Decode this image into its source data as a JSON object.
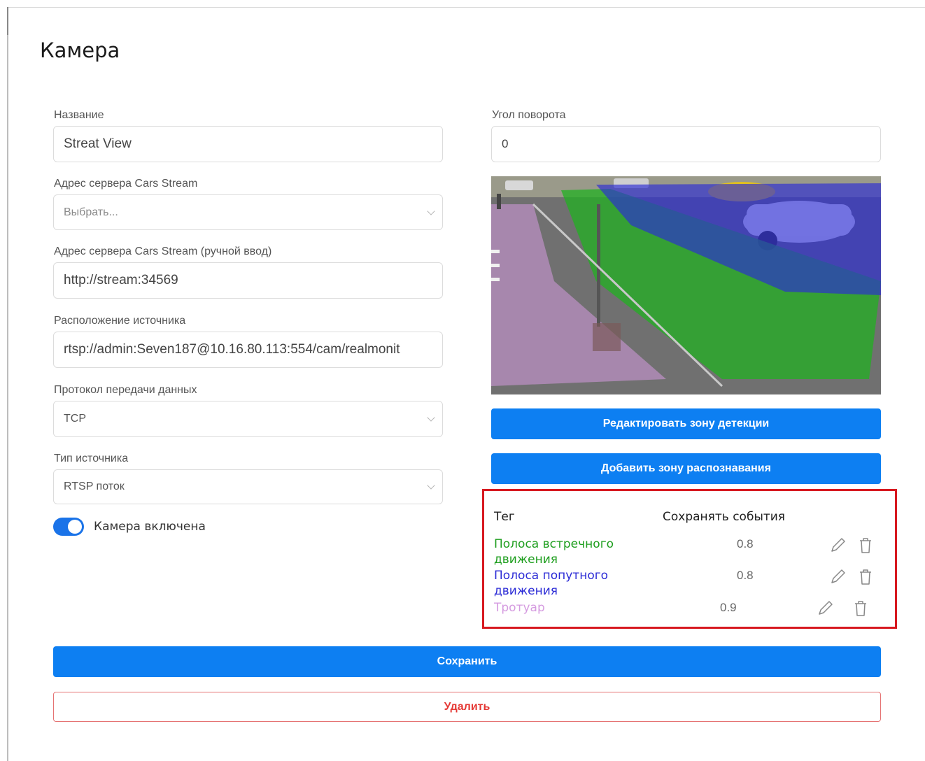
{
  "page": {
    "title": "Камера"
  },
  "form": {
    "name": {
      "label": "Название",
      "value": "Streat View"
    },
    "server": {
      "label": "Адрес сервера Cars Stream",
      "placeholder": "Выбрать..."
    },
    "server_manual": {
      "label": "Адрес сервера Cars Stream (ручной ввод)",
      "value": "http://stream:34569"
    },
    "source_location": {
      "label": "Расположение источника",
      "value": "rtsp://admin:Seven187@10.16.80.113:554/cam/realmonit"
    },
    "protocol": {
      "label": "Протокол передачи данных",
      "value": "TCP"
    },
    "source_type": {
      "label": "Тип источника",
      "value": "RTSP поток"
    },
    "camera_enabled": {
      "label": "Камера включена",
      "checked": true
    },
    "rotation": {
      "label": "Угол поворота",
      "value": "0"
    }
  },
  "buttons": {
    "edit_zone": "Редактировать зону детекции",
    "add_zone": "Добавить зону распознавания",
    "save": "Сохранить",
    "delete": "Удалить"
  },
  "zones_table": {
    "headers": {
      "tag": "Тег",
      "save_events": "Сохранять события"
    },
    "rows": [
      {
        "tag": "Полоса встречного движения",
        "value": "0.8",
        "color": "#1e9e1e",
        "edit_icon": "pencil-icon",
        "delete_icon": "trash-icon"
      },
      {
        "tag": "Полоса попутного движения",
        "value": "0.8",
        "color": "#2b2bd6",
        "edit_icon": "pencil-icon",
        "delete_icon": "trash-icon"
      },
      {
        "tag": "Тротуар",
        "value": "0.9",
        "color": "#d59be0",
        "edit_icon": "pencil-icon",
        "delete_icon": "trash-icon"
      }
    ]
  },
  "colors": {
    "primary": "#0d7ff2",
    "danger": "#e53935",
    "highlight_border": "#d71920",
    "zone_oncoming": "#1e9e1e",
    "zone_passing": "#2b2bd6",
    "zone_sidewalk": "#d59be0"
  }
}
